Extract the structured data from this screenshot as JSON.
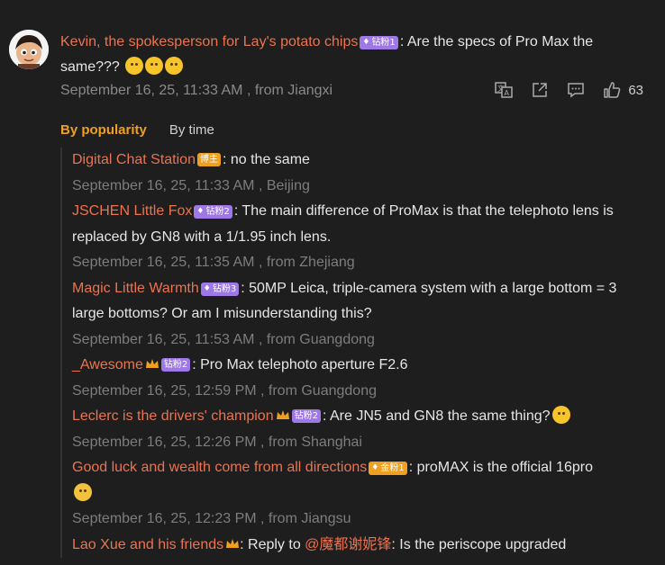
{
  "top_comment": {
    "username": "Kevin, the spokesperson for Lay's potato chips",
    "badge": "钻粉1",
    "text": ": Are the specs of Pro Max the same???",
    "time": "September 16, 25, 11:33 AM",
    "location_sep": " , from Jiangxi",
    "like_count": "63",
    "avatar_icon": "cartoon-boy-avatar"
  },
  "tabs": {
    "popularity": "By popularity",
    "time": "By time"
  },
  "replies": [
    {
      "username": "Digital Chat Station",
      "badge": "博主",
      "badge_color": "orange",
      "text": ": no the same",
      "meta": "September 16, 25, 11:33 AM , Beijing"
    },
    {
      "username": "JSCHEN Little Fox",
      "badge": "钻粉2",
      "badge_color": "purple",
      "text": ": The main difference of ProMax is that the telephoto lens is replaced by GN8 with a 1/1.95 inch lens.",
      "meta": "September 16, 25, 11:35 AM , from Zhejiang"
    },
    {
      "username": "Magic Little Warmth",
      "badge": "钻粉3",
      "badge_color": "purple",
      "text": ": 50MP Leica, triple-camera system with a large bottom = 3 large bottoms? Or am I misunderstanding this?",
      "meta": "September 16, 25, 11:53 AM , from Guangdong"
    },
    {
      "username": "_Awesome",
      "badge": "钻粉2",
      "badge_color": "purple",
      "text": ": Pro Max telephoto aperture F2.6",
      "meta": "September 16, 25, 12:59 PM , from Guangdong"
    },
    {
      "username": "Leclerc is the drivers' champion",
      "badge": "钻粉2",
      "badge_color": "purple",
      "text": ": Are JN5 and GN8 the same thing?",
      "meta": "September 16, 25, 12:26 PM , from Shanghai"
    },
    {
      "username": "Good luck and wealth come from all directions",
      "badge": "金粉1",
      "badge_color": "orange",
      "text": ": proMAX is the official 16pro",
      "meta": "September 16, 25, 12:23 PM , from Jiangsu"
    },
    {
      "username": "Lao Xue and his friends",
      "text_prefix": ": Reply to ",
      "mention": "@魔都谢妮锋",
      "text": ": Is the periscope upgraded"
    }
  ],
  "colors": {
    "background": "#1e1e1e",
    "username": "#eb7350",
    "meta": "#7d7d7d",
    "active_tab": "#f0a020",
    "badge_purple": "#9d78e6",
    "badge_orange": "#f0a020"
  }
}
